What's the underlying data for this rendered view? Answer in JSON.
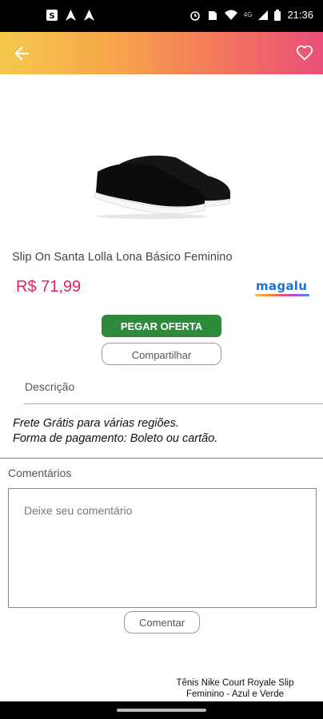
{
  "status_bar": {
    "time": "21:36",
    "signal_label": "4G"
  },
  "app_bar": {
    "back_icon": "arrow-back-icon",
    "favorite_icon": "heart-outline-icon"
  },
  "product": {
    "title": "Slip On Santa Lolla Lona Básico Feminino",
    "price": "R$ 71,99",
    "store": "Magalu"
  },
  "actions": {
    "offer_label": "PEGAR OFERTA",
    "share_label": "Compartilhar"
  },
  "description": {
    "heading": "Descrição",
    "line1": "Frete Grátis para várias regiões.",
    "line2": "Forma de pagamento: Boleto ou cartão."
  },
  "comments": {
    "heading": "Comentários",
    "placeholder": "Deixe seu comentário",
    "submit_label": "Comentar"
  },
  "related": {
    "title_line1": "Tênis Nike Court Royale Slip",
    "title_line2": "Feminino - Azul e Verde"
  },
  "colors": {
    "price": "#e0245e",
    "offer_button": "#2e8b3e",
    "store_brand": "#1e73d8"
  }
}
